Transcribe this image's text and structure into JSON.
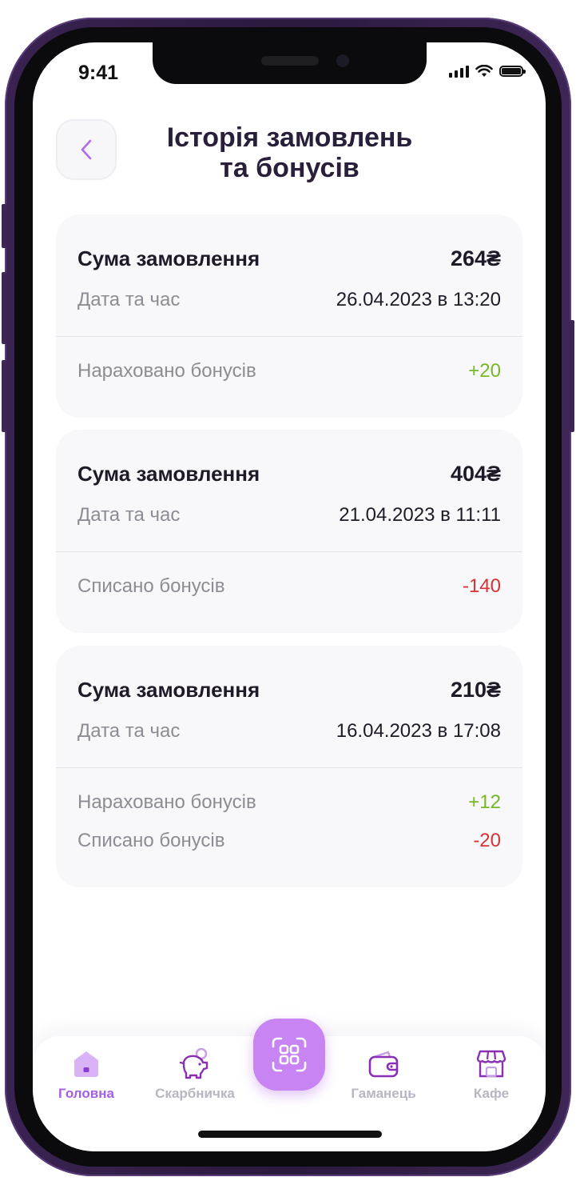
{
  "status": {
    "time": "9:41"
  },
  "header": {
    "title_line1": "Історія замовлень",
    "title_line2": "та бонусів"
  },
  "orders": [
    {
      "sum_label": "Сума замовлення",
      "sum_value": "264₴",
      "date_label": "Дата та час",
      "date_value": "26.04.2023 в 13:20",
      "bonuses": [
        {
          "label": "Нараховано бонусів",
          "value": "+20",
          "type": "plus"
        }
      ]
    },
    {
      "sum_label": "Сума замовлення",
      "sum_value": "404₴",
      "date_label": "Дата та час",
      "date_value": "21.04.2023 в 11:11",
      "bonuses": [
        {
          "label": "Списано бонусів",
          "value": "-140",
          "type": "minus"
        }
      ]
    },
    {
      "sum_label": "Сума замовлення",
      "sum_value": "210₴",
      "date_label": "Дата та час",
      "date_value": "16.04.2023 в 17:08",
      "bonuses": [
        {
          "label": "Нараховано бонусів",
          "value": "+12",
          "type": "plus"
        },
        {
          "label": "Списано бонусів",
          "value": "-20",
          "type": "minus"
        }
      ]
    }
  ],
  "tabbar": {
    "items": [
      {
        "label": "Головна",
        "icon": "home-icon",
        "active": true
      },
      {
        "label": "Скарбничка",
        "icon": "piggy-bank-icon",
        "active": false
      },
      {
        "label": "Гаманець",
        "icon": "wallet-icon",
        "active": false
      },
      {
        "label": "Кафе",
        "icon": "cafe-icon",
        "active": false
      }
    ],
    "center_icon": "qr-scan-icon"
  },
  "colors": {
    "accent": "#a55fe3",
    "plus": "#74b826",
    "minus": "#d93232",
    "frame": "#3a2352"
  }
}
